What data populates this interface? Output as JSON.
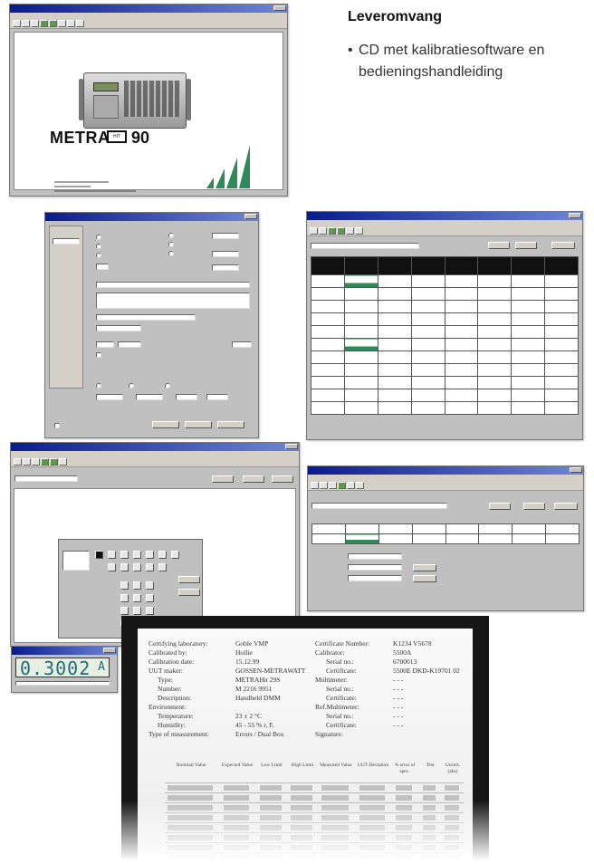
{
  "spec": {
    "title": "Leveromvang",
    "bullet": "•",
    "items": [
      "CD met kalibratiesoftware en bedieningshandleiding"
    ]
  },
  "splash": {
    "brand": "METRA",
    "model_badge": "HIT",
    "model_number": "90"
  },
  "readout": {
    "digits": "0.3002",
    "unit": "A"
  },
  "certificate": {
    "left_fields": [
      {
        "label": "Certifying laboratory:",
        "value": "Goble VMP"
      },
      {
        "label": "Calibrated by:",
        "value": "Hollie"
      },
      {
        "label": "Calibration date:",
        "value": "15.12.99"
      },
      {
        "label": "UUT maker:",
        "value": "GOSSEN-METRAWATT"
      },
      {
        "label": "Type:",
        "value": "METRAHit 29S"
      },
      {
        "label": "Number:",
        "value": "M 2216 9951"
      },
      {
        "label": "Description:",
        "value": "Handheld DMM"
      },
      {
        "label": "Environment:",
        "value": ""
      },
      {
        "label": "Temperature:",
        "value": "23 ± 2 °C"
      },
      {
        "label": "Humidity:",
        "value": "45 - 55 % r. F."
      },
      {
        "label": "Type of measurement:",
        "value": "Errors / Dual Box"
      }
    ],
    "right_fields": [
      {
        "label": "Certificate Number:",
        "value": "K1234 V5678"
      },
      {
        "label": "Calibrator:",
        "value": "5500A"
      },
      {
        "label": "Serial no.:",
        "value": "6700013"
      },
      {
        "label": "Certificate:",
        "value": "5500E DKD-K19701 02"
      },
      {
        "label": "Multimeter:",
        "value": "- - -"
      },
      {
        "label": "Serial no.:",
        "value": "- - -"
      },
      {
        "label": "Certificate:",
        "value": "- - -"
      },
      {
        "label": "Ref.Multimeter:",
        "value": "- - -"
      },
      {
        "label": "Serial no.:",
        "value": "- - -"
      },
      {
        "label": "Certificate:",
        "value": "- - -"
      },
      {
        "label": "Signature:",
        "value": ""
      }
    ],
    "columns": [
      "Nominal Value",
      "Expected Value",
      "Low Limit",
      "High Limit",
      "Measured Value",
      "UUT Deviation",
      "% error of spec.",
      "Test",
      "Uncert. (abs)"
    ]
  }
}
